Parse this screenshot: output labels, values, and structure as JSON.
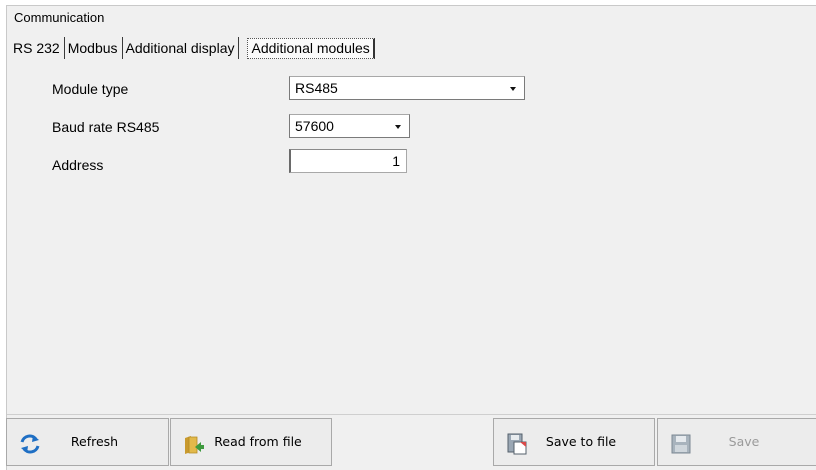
{
  "window": {
    "title": "Communication"
  },
  "tabs": [
    {
      "label": "RS 232"
    },
    {
      "label": "Modbus"
    },
    {
      "label": "Additional display"
    },
    {
      "label": "Additional modules",
      "active": true
    }
  ],
  "form": {
    "module_type": {
      "label": "Module type",
      "value": "RS485"
    },
    "baud_rate": {
      "label": "Baud rate RS485",
      "value": "57600"
    },
    "address": {
      "label": "Address",
      "value": "1"
    }
  },
  "buttons": {
    "refresh": {
      "label": "Refresh",
      "icon": "refresh-icon"
    },
    "read": {
      "label": "Read from file",
      "icon": "folder-open-icon"
    },
    "save_to_file": {
      "label": "Save to file",
      "icon": "save-to-file-icon"
    },
    "save": {
      "label": "Save",
      "icon": "floppy-disk-icon",
      "disabled": true
    }
  },
  "colors": {
    "refresh_icon": "#1f6fc4",
    "folder": "#e2b94a",
    "folder_arrow": "#3e9a3e",
    "disk": "#9aa7b4"
  }
}
